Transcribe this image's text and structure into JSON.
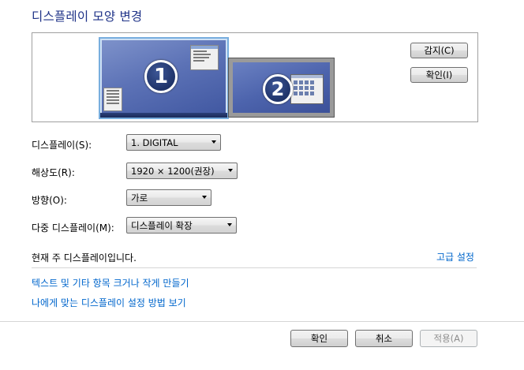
{
  "title": "디스플레이 모양 변경",
  "preview": {
    "monitor1_number": "1",
    "monitor2_number": "2",
    "detect_label": "감지(C)",
    "identify_label": "확인(I)"
  },
  "settings": {
    "display_label": "디스플레이(S):",
    "display_value": "1. DIGITAL",
    "resolution_label": "해상도(R):",
    "resolution_value": "1920 × 1200(권장)",
    "orientation_label": "방향(O):",
    "orientation_value": "가로",
    "multi_label": "다중 디스플레이(M):",
    "multi_value": "디스플레이 확장"
  },
  "status_text": "현재 주 디스플레이입니다.",
  "advanced_link": "고급 설정",
  "links": {
    "text_size": "텍스트 및 기타 항목 크거나 작게 만들기",
    "help": "나에게 맞는 디스플레이 설정 방법 보기"
  },
  "footer": {
    "ok": "확인",
    "cancel": "취소",
    "apply": "적용(A)"
  },
  "colors": {
    "title": "#1e3287",
    "link": "#0066cc",
    "selected_border": "#78aede"
  }
}
